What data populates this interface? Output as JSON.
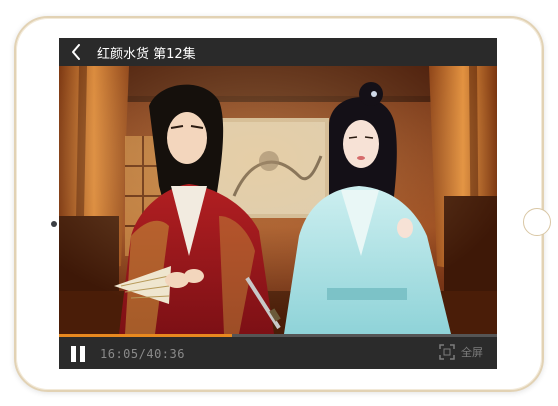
{
  "player": {
    "title": "红颜水货  第12集",
    "back_icon": "chevron-left-icon",
    "time": "16:05/40:36",
    "progress": 0.395,
    "fullscreen_label": "全屏",
    "fullscreen_icon": "fullscreen-icon",
    "pause_icon": "pause-icon"
  },
  "colors": {
    "accent": "#e8891f",
    "topbar": "#2a2a2a",
    "controls": "#2b2b2b",
    "tablet_frame": "#e2d2b4"
  }
}
